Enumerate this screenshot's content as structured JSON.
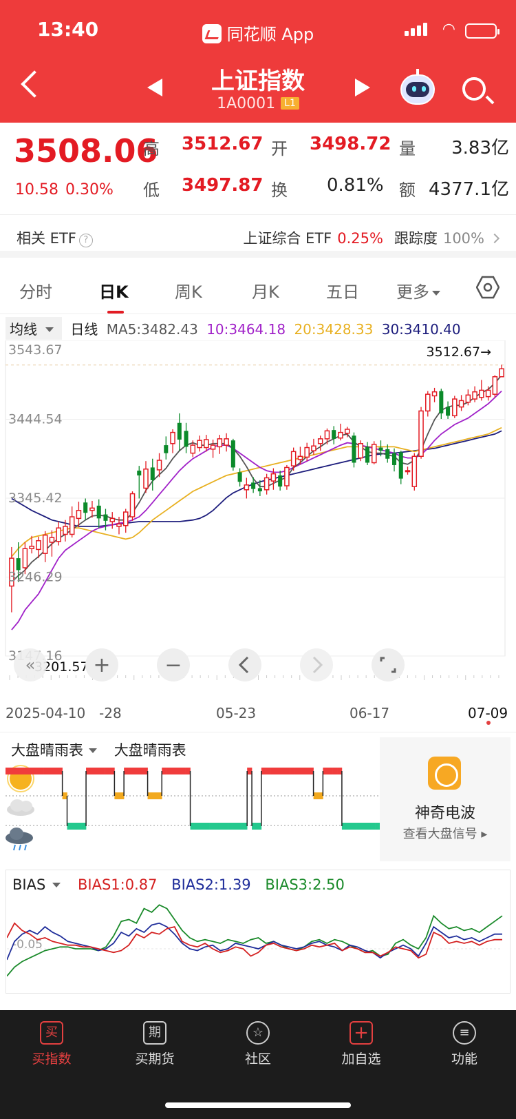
{
  "status": {
    "time": "13:40",
    "app": "同花顺 App"
  },
  "nav": {
    "title": "上证指数",
    "code": "1A0001",
    "level": "L1"
  },
  "quote": {
    "price": "3508.06",
    "change": "10.58",
    "change_pct": "0.30%",
    "high_label": "高",
    "high": "3512.67",
    "open_label": "开",
    "open": "3498.72",
    "vol_label": "量",
    "vol": "3.83亿",
    "low_label": "低",
    "low": "3497.87",
    "turn_label": "换",
    "turn": "0.81%",
    "amt_label": "额",
    "amt": "4377.1亿"
  },
  "etf": {
    "label": "相关 ETF",
    "help": "?",
    "name": "上证综合 ETF",
    "pct": "0.25%",
    "track_label": "跟踪度",
    "track": "100%"
  },
  "tabs": [
    "分时",
    "日K",
    "周K",
    "月K",
    "五日",
    "更多"
  ],
  "ma_legend": {
    "selector": "均线",
    "kind": "日线",
    "ma5": "MA5:3482.43",
    "ma10": "10:3464.18",
    "ma20": "20:3428.33",
    "ma30": "30:3410.40",
    "colors": {
      "ma5": "#555555",
      "ma10": "#a020c8",
      "ma20": "#e8b020",
      "ma30": "#1c1c7c"
    }
  },
  "chart_data": {
    "type": "candlestick",
    "y_ticks": [
      "3543.67",
      "3444.54",
      "3345.42",
      "3246.29",
      "3147.16"
    ],
    "ylim": [
      3147.16,
      3543.67
    ],
    "high_marker": "3512.67→",
    "low_marker": "3201.57",
    "x_ticks": [
      "2025-04-10",
      "-28",
      "05-23",
      "06-17",
      "07-09"
    ],
    "up_color": "#e31b23",
    "down_color": "#0b8a2a",
    "candles": [
      {
        "o": 3235,
        "c": 3270,
        "h": 3284,
        "l": 3202
      },
      {
        "o": 3270,
        "c": 3255,
        "h": 3290,
        "l": 3240
      },
      {
        "o": 3258,
        "c": 3282,
        "h": 3290,
        "l": 3250
      },
      {
        "o": 3282,
        "c": 3285,
        "h": 3298,
        "l": 3276
      },
      {
        "o": 3281,
        "c": 3292,
        "h": 3297,
        "l": 3270
      },
      {
        "o": 3276,
        "c": 3299,
        "h": 3304,
        "l": 3265
      },
      {
        "o": 3290,
        "c": 3296,
        "h": 3305,
        "l": 3272
      },
      {
        "o": 3291,
        "c": 3308,
        "h": 3316,
        "l": 3286
      },
      {
        "o": 3300,
        "c": 3310,
        "h": 3318,
        "l": 3291
      },
      {
        "o": 3300,
        "c": 3322,
        "h": 3335,
        "l": 3296
      },
      {
        "o": 3320,
        "c": 3330,
        "h": 3341,
        "l": 3309
      },
      {
        "o": 3340,
        "c": 3327,
        "h": 3345,
        "l": 3318
      },
      {
        "o": 3330,
        "c": 3333,
        "h": 3342,
        "l": 3321
      },
      {
        "o": 3336,
        "c": 3320,
        "h": 3344,
        "l": 3308
      },
      {
        "o": 3325,
        "c": 3317,
        "h": 3332,
        "l": 3305
      },
      {
        "o": 3316,
        "c": 3320,
        "h": 3328,
        "l": 3307
      },
      {
        "o": 3310,
        "c": 3313,
        "h": 3322,
        "l": 3300
      },
      {
        "o": 3311,
        "c": 3328,
        "h": 3332,
        "l": 3302
      },
      {
        "o": 3322,
        "c": 3351,
        "h": 3354,
        "l": 3317
      },
      {
        "o": 3380,
        "c": 3374,
        "h": 3386,
        "l": 3345
      },
      {
        "o": 3358,
        "c": 3382,
        "h": 3392,
        "l": 3352
      },
      {
        "o": 3384,
        "c": 3368,
        "h": 3395,
        "l": 3355
      },
      {
        "o": 3381,
        "c": 3393,
        "h": 3402,
        "l": 3372
      },
      {
        "o": 3412,
        "c": 3402,
        "h": 3423,
        "l": 3394
      },
      {
        "o": 3414,
        "c": 3428,
        "h": 3432,
        "l": 3402
      },
      {
        "o": 3440,
        "c": 3419,
        "h": 3452,
        "l": 3405
      },
      {
        "o": 3430,
        "c": 3410,
        "h": 3440,
        "l": 3402
      },
      {
        "o": 3402,
        "c": 3412,
        "h": 3418,
        "l": 3397
      },
      {
        "o": 3409,
        "c": 3418,
        "h": 3424,
        "l": 3404
      },
      {
        "o": 3409,
        "c": 3419,
        "h": 3425,
        "l": 3404
      },
      {
        "o": 3407,
        "c": 3412,
        "h": 3419,
        "l": 3396
      },
      {
        "o": 3410,
        "c": 3420,
        "h": 3425,
        "l": 3401
      },
      {
        "o": 3412,
        "c": 3420,
        "h": 3427,
        "l": 3404
      },
      {
        "o": 3418,
        "c": 3384,
        "h": 3420,
        "l": 3380
      },
      {
        "o": 3378,
        "c": 3366,
        "h": 3383,
        "l": 3360
      },
      {
        "o": 3356,
        "c": 3362,
        "h": 3371,
        "l": 3345
      },
      {
        "o": 3365,
        "c": 3357,
        "h": 3372,
        "l": 3352
      },
      {
        "o": 3358,
        "c": 3354,
        "h": 3368,
        "l": 3348
      },
      {
        "o": 3356,
        "c": 3371,
        "h": 3376,
        "l": 3350
      },
      {
        "o": 3367,
        "c": 3376,
        "h": 3383,
        "l": 3356
      },
      {
        "o": 3374,
        "c": 3360,
        "h": 3380,
        "l": 3355
      },
      {
        "o": 3361,
        "c": 3384,
        "h": 3387,
        "l": 3356
      },
      {
        "o": 3386,
        "c": 3404,
        "h": 3409,
        "l": 3380
      },
      {
        "o": 3394,
        "c": 3398,
        "h": 3410,
        "l": 3388
      },
      {
        "o": 3397,
        "c": 3409,
        "h": 3415,
        "l": 3392
      },
      {
        "o": 3405,
        "c": 3411,
        "h": 3420,
        "l": 3400
      },
      {
        "o": 3414,
        "c": 3420,
        "h": 3424,
        "l": 3405
      },
      {
        "o": 3420,
        "c": 3430,
        "h": 3433,
        "l": 3413
      },
      {
        "o": 3431,
        "c": 3420,
        "h": 3436,
        "l": 3413
      },
      {
        "o": 3421,
        "c": 3428,
        "h": 3439,
        "l": 3418
      },
      {
        "o": 3427,
        "c": 3432,
        "h": 3435,
        "l": 3422
      },
      {
        "o": 3424,
        "c": 3390,
        "h": 3428,
        "l": 3384
      },
      {
        "o": 3396,
        "c": 3414,
        "h": 3418,
        "l": 3392
      },
      {
        "o": 3410,
        "c": 3390,
        "h": 3416,
        "l": 3387
      },
      {
        "o": 3390,
        "c": 3413,
        "h": 3417,
        "l": 3388
      },
      {
        "o": 3409,
        "c": 3405,
        "h": 3418,
        "l": 3398
      },
      {
        "o": 3407,
        "c": 3395,
        "h": 3413,
        "l": 3390
      },
      {
        "o": 3402,
        "c": 3387,
        "h": 3408,
        "l": 3379
      },
      {
        "o": 3403,
        "c": 3370,
        "h": 3405,
        "l": 3363
      },
      {
        "o": 3379,
        "c": 3380,
        "h": 3385,
        "l": 3375
      },
      {
        "o": 3360,
        "c": 3398,
        "h": 3402,
        "l": 3355
      },
      {
        "o": 3398,
        "c": 3455,
        "h": 3460,
        "l": 3395
      },
      {
        "o": 3455,
        "c": 3476,
        "h": 3480,
        "l": 3448
      },
      {
        "o": 3474,
        "c": 3479,
        "h": 3484,
        "l": 3466
      },
      {
        "o": 3480,
        "c": 3452,
        "h": 3483,
        "l": 3445
      },
      {
        "o": 3460,
        "c": 3449,
        "h": 3467,
        "l": 3445
      },
      {
        "o": 3449,
        "c": 3470,
        "h": 3474,
        "l": 3446
      },
      {
        "o": 3460,
        "c": 3468,
        "h": 3475,
        "l": 3455
      },
      {
        "o": 3466,
        "c": 3475,
        "h": 3482,
        "l": 3462
      },
      {
        "o": 3470,
        "c": 3479,
        "h": 3486,
        "l": 3466
      },
      {
        "o": 3472,
        "c": 3481,
        "h": 3494,
        "l": 3468
      },
      {
        "o": 3473,
        "c": 3481,
        "h": 3486,
        "l": 3468
      },
      {
        "o": 3476,
        "c": 3498,
        "h": 3500,
        "l": 3472
      },
      {
        "o": 3498,
        "c": 3508,
        "h": 3513,
        "l": 3498
      }
    ],
    "ma5": [
      3240,
      3248,
      3255,
      3265,
      3272,
      3280,
      3288,
      3295,
      3300,
      3306,
      3312,
      3318,
      3323,
      3324,
      3323,
      3320,
      3318,
      3318,
      3327,
      3340,
      3355,
      3367,
      3375,
      3383,
      3395,
      3405,
      3412,
      3415,
      3412,
      3412,
      3414,
      3414,
      3414,
      3408,
      3398,
      3385,
      3370,
      3360,
      3360,
      3364,
      3368,
      3372,
      3384,
      3390,
      3398,
      3405,
      3410,
      3416,
      3420,
      3424,
      3426,
      3416,
      3410,
      3404,
      3402,
      3402,
      3400,
      3398,
      3390,
      3388,
      3393,
      3406,
      3426,
      3444,
      3456,
      3460,
      3462,
      3462,
      3466,
      3472,
      3478,
      3482,
      3490,
      3500
    ],
    "ma10": [
      3180,
      3190,
      3205,
      3215,
      3225,
      3240,
      3255,
      3270,
      3280,
      3286,
      3292,
      3298,
      3304,
      3308,
      3310,
      3312,
      3314,
      3315,
      3318,
      3322,
      3330,
      3340,
      3350,
      3360,
      3370,
      3380,
      3388,
      3395,
      3400,
      3405,
      3410,
      3412,
      3412,
      3408,
      3402,
      3396,
      3390,
      3384,
      3380,
      3378,
      3378,
      3380,
      3384,
      3388,
      3392,
      3396,
      3400,
      3404,
      3408,
      3412,
      3415,
      3414,
      3412,
      3410,
      3408,
      3406,
      3404,
      3402,
      3398,
      3396,
      3396,
      3400,
      3408,
      3418,
      3426,
      3432,
      3438,
      3442,
      3446,
      3452,
      3458,
      3464,
      3472,
      3480
    ],
    "ma20": [
      3272,
      3282,
      3290,
      3296,
      3298,
      3300,
      3302,
      3304,
      3306,
      3308,
      3308,
      3306,
      3304,
      3302,
      3300,
      3298,
      3296,
      3294,
      3296,
      3302,
      3310,
      3318,
      3324,
      3330,
      3336,
      3342,
      3348,
      3354,
      3358,
      3362,
      3366,
      3370,
      3374,
      3376,
      3378,
      3380,
      3382,
      3384,
      3386,
      3388,
      3390,
      3392,
      3394,
      3396,
      3398,
      3400,
      3402,
      3404,
      3406,
      3408,
      3410,
      3410,
      3410,
      3410,
      3410,
      3410,
      3410,
      3410,
      3408,
      3406,
      3404,
      3406,
      3408,
      3410,
      3412,
      3414,
      3416,
      3418,
      3420,
      3422,
      3424,
      3426,
      3430,
      3434
    ],
    "ma30": [
      3345,
      3340,
      3335,
      3330,
      3326,
      3322,
      3318,
      3316,
      3314,
      3312,
      3310,
      3310,
      3310,
      3310,
      3311,
      3312,
      3313,
      3314,
      3315,
      3316,
      3316,
      3316,
      3316,
      3316,
      3316,
      3316,
      3317,
      3318,
      3320,
      3324,
      3330,
      3338,
      3346,
      3352,
      3356,
      3360,
      3363,
      3366,
      3368,
      3370,
      3372,
      3374,
      3376,
      3378,
      3380,
      3382,
      3384,
      3386,
      3388,
      3390,
      3392,
      3394,
      3396,
      3398,
      3400,
      3401,
      3402,
      3402,
      3403,
      3404,
      3405,
      3406,
      3407,
      3408,
      3410,
      3412,
      3414,
      3416,
      3418,
      3420,
      3422,
      3424,
      3426,
      3430
    ]
  },
  "controls": {
    "zoom_in": "+",
    "zoom_out": "−"
  },
  "weather": {
    "selector": "大盘晴雨表",
    "title": "大盘晴雨表",
    "states": [
      "sunny",
      "sunny",
      "sunny",
      "sunny",
      "sunny",
      "sunny",
      "sunny",
      "sunny",
      "sunny",
      "sunny",
      "sunny",
      "sunny",
      "cloudy",
      "stormy",
      "stormy",
      "stormy",
      "stormy",
      "sunny",
      "sunny",
      "sunny",
      "sunny",
      "sunny",
      "sunny",
      "cloudy",
      "cloudy",
      "sunny",
      "sunny",
      "sunny",
      "sunny",
      "sunny",
      "cloudy",
      "cloudy",
      "cloudy",
      "sunny",
      "sunny",
      "sunny",
      "sunny",
      "sunny",
      "sunny",
      "stormy",
      "stormy",
      "stormy",
      "stormy",
      "stormy",
      "stormy",
      "stormy",
      "stormy",
      "stormy",
      "stormy",
      "stormy",
      "stormy",
      "sunny",
      "stormy",
      "stormy",
      "sunny",
      "sunny",
      "sunny",
      "sunny",
      "sunny",
      "sunny",
      "sunny",
      "sunny",
      "sunny",
      "sunny",
      "sunny",
      "cloudy",
      "cloudy",
      "sunny",
      "sunny",
      "sunny",
      "sunny",
      "stormy",
      "stormy",
      "stormy",
      "stormy",
      "stormy",
      "stormy",
      "stormy",
      "stormy"
    ],
    "colors": {
      "sunny": "#f03c3c",
      "cloudy": "#f2a91e",
      "stormy": "#24c98e"
    }
  },
  "wave": {
    "title": "神奇电波",
    "subtitle": "查看大盘信号 ▸"
  },
  "bias": {
    "selector": "BIAS",
    "bias1": "BIAS1:0.87",
    "bias2": "BIAS2:1.39",
    "bias3": "BIAS3:2.50",
    "zero_label": "-0.05",
    "colors": {
      "bias1": "#d42020",
      "bias2": "#1f2d9a",
      "bias3": "#1a8a2a"
    },
    "bias1_values": [
      0.6,
      1.4,
      1.0,
      0.8,
      0.5,
      0.6,
      0.4,
      0.3,
      0.2,
      0.2,
      0.1,
      0.1,
      0.0,
      -0.1,
      -0.2,
      -0.1,
      0.2,
      0.8,
      0.6,
      0.9,
      0.8,
      1.1,
      1.2,
      0.4,
      0.2,
      0.1,
      0.3,
      0.0,
      -0.2,
      -0.1,
      0.1,
      0.0,
      -0.4,
      -0.2,
      0.2,
      0.3,
      0.1,
      0.0,
      -0.1,
      0.0,
      0.2,
      0.1,
      0.2,
      0.3,
      -0.1,
      0.1,
      0.0,
      -0.2,
      -0.2,
      -0.4,
      -0.2,
      0.1,
      0.0,
      -0.1,
      -0.5,
      -0.3,
      0.9,
      0.7,
      0.3,
      0.4,
      0.3,
      0.4,
      0.2,
      0.4,
      0.5,
      0.5
    ],
    "bias2_values": [
      -0.6,
      0.4,
      0.8,
      1.0,
      0.8,
      1.2,
      0.9,
      0.7,
      0.4,
      0.3,
      0.2,
      0.1,
      -0.1,
      0.0,
      0.3,
      0.9,
      0.7,
      1.1,
      0.9,
      1.3,
      1.4,
      1.2,
      0.8,
      0.3,
      0.0,
      -0.1,
      0.1,
      0.2,
      -0.1,
      0.0,
      0.3,
      0.2,
      0.1,
      0.0,
      0.2,
      0.4,
      0.2,
      0.1,
      0.0,
      0.1,
      0.3,
      0.4,
      0.2,
      0.1,
      -0.1,
      0.2,
      0.1,
      -0.1,
      -0.2,
      -0.5,
      -0.2,
      0.0,
      0.2,
      0.0,
      -0.4,
      0.3,
      1.2,
      0.9,
      0.6,
      0.7,
      0.5,
      0.6,
      0.4,
      0.6,
      0.8,
      0.8
    ],
    "bias3_values": [
      -1.5,
      -1.0,
      -0.7,
      -0.5,
      -0.3,
      -0.1,
      0.0,
      0.1,
      0.1,
      0.0,
      0.0,
      0.0,
      -0.1,
      0.1,
      0.7,
      1.5,
      1.6,
      1.4,
      2.2,
      2.0,
      2.4,
      2.2,
      1.6,
      1.0,
      0.6,
      0.4,
      0.5,
      0.4,
      0.3,
      0.5,
      0.4,
      0.3,
      0.5,
      0.6,
      0.3,
      0.4,
      0.2,
      0.0,
      -0.1,
      0.1,
      0.4,
      0.5,
      0.3,
      0.5,
      0.4,
      0.2,
      0.0,
      -0.2,
      -0.1,
      -0.4,
      -0.3,
      0.3,
      0.5,
      0.2,
      0.0,
      0.6,
      1.8,
      1.4,
      1.1,
      1.2,
      1.0,
      1.1,
      0.9,
      1.2,
      1.5,
      1.8
    ]
  },
  "bottom": [
    "买指数",
    "买期货",
    "社区",
    "加自选",
    "功能"
  ],
  "bottom_icons": [
    "买",
    "期",
    "☆",
    "+",
    "≡"
  ]
}
